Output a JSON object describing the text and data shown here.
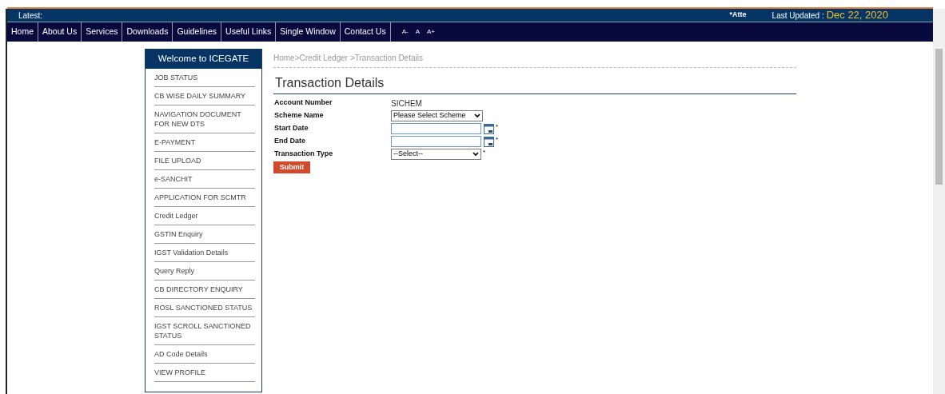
{
  "ticker": {
    "label": "Latest:",
    "notice": "*Atte",
    "updated_label": "Last Updated :",
    "updated_date": "Dec 22, 2020"
  },
  "nav": [
    "Home",
    "About Us",
    "Services",
    "Downloads",
    "Guidelines",
    "Useful Links",
    "Single Window",
    "Contact Us"
  ],
  "font_sizes": [
    "A-",
    "A",
    "A+"
  ],
  "sidebar": {
    "title": "Welcome to ICEGATE",
    "items": [
      "JOB STATUS",
      "CB WISE DAILY SUMMARY",
      "NAVIGATION DOCUMENT FOR NEW DTS",
      "E-PAYMENT",
      "FILE UPLOAD",
      "e-SANCHIT",
      "APPLICATION FOR SCMTR",
      "Credit Ledger",
      "GSTIN Enquiry",
      "IGST Validation Details",
      "Query Reply",
      "CB DIRECTORY ENQUIRY",
      "ROSL SANCTIONED STATUS",
      "IGST SCROLL SANCTIONED STATUS",
      "AD Code Details",
      "VIEW PROFILE"
    ]
  },
  "breadcrumb": [
    "Home",
    ">Credit Ledger ",
    ">Transaction Details"
  ],
  "heading": "Transaction Details",
  "form": [
    {
      "kind": "text",
      "label": "Account Number",
      "value": "SICHEM"
    },
    {
      "kind": "select",
      "label": "Scheme Name",
      "value": "Please Select Scheme"
    },
    {
      "kind": "date",
      "label": "Start Date",
      "mark": "*"
    },
    {
      "kind": "date",
      "label": "End Date",
      "mark": "*"
    },
    {
      "kind": "select",
      "label": "Transaction Type",
      "value": "--Select--",
      "mark": "*"
    }
  ],
  "submit": "Submit"
}
